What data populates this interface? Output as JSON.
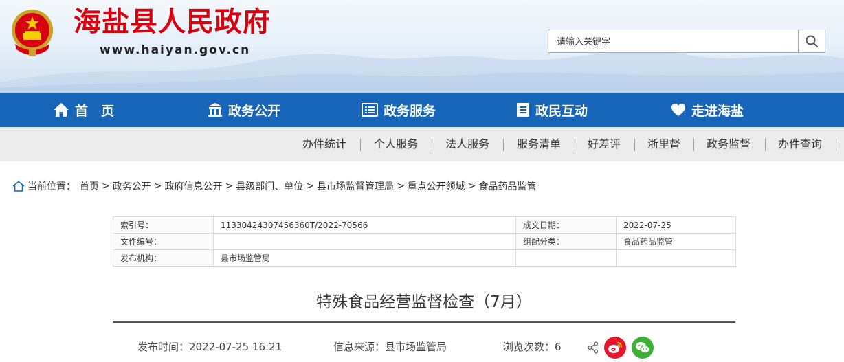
{
  "header": {
    "site_title": "海盐县人民政府",
    "site_url": "www.haiyan.gov.cn",
    "emblem_icon": "national-emblem-icon",
    "search": {
      "placeholder": "请输入关键字",
      "value": "",
      "button_icon": "search-icon"
    }
  },
  "main_nav": {
    "items": [
      {
        "label": "首　页",
        "icon": "home-icon"
      },
      {
        "label": "政务公开",
        "icon": "building-icon"
      },
      {
        "label": "政务服务",
        "icon": "list-icon"
      },
      {
        "label": "政民互动",
        "icon": "document-icon"
      },
      {
        "label": "走进海盐",
        "icon": "heart-icon"
      }
    ],
    "background": "#1665b9"
  },
  "sub_nav": {
    "items": [
      "办件统计",
      "个人服务",
      "法人服务",
      "服务清单",
      "好差评",
      "浙里督",
      "政务监督",
      "办件查询"
    ]
  },
  "breadcrumb": {
    "label": "当前位置：",
    "icon": "home-outline-icon",
    "items": [
      "首页",
      "政务公开",
      "政府信息公开",
      "县级部门、单位",
      "县市场监督管理局",
      "重点公开领域",
      "食品药品监管"
    ],
    "separator": ">"
  },
  "info_table": {
    "index_label": "索引号：",
    "index_value": "11330424307456360T/2022-70566",
    "date_label": "成文日期：",
    "date_value": "2022-07-25",
    "file_no_label": "文件编号：",
    "file_no_value": "",
    "category_label": "组配分类：",
    "category_value": "食品药品监管",
    "issuer_label": "发布机构：",
    "issuer_value": "县市场监管局"
  },
  "article": {
    "title": "特殊食品经营监督检查（7月）",
    "publish_time": "发布时间：2022-07-25 16:21",
    "source": "信息来源：县市场监管局",
    "views": "浏览次数：6",
    "share_icons": [
      "share-icon",
      "weibo-icon",
      "wechat-icon"
    ],
    "weibo_color": "#e6162d",
    "wechat_color": "#3cb034"
  }
}
